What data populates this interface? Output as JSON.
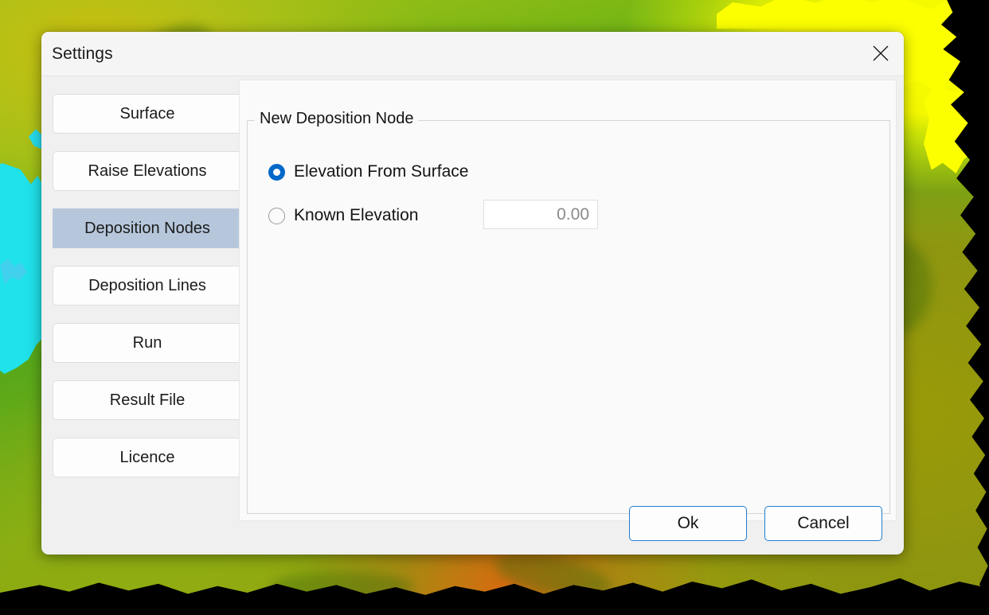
{
  "background": {
    "type": "terrain-elevation-raster",
    "colors": {
      "high": "#fcff00",
      "mid": "#9ab012",
      "low": "#57a81a",
      "water": "#1fe2ea",
      "hot": "#d86a10",
      "nodata": "#000000"
    }
  },
  "dialog": {
    "title": "Settings",
    "close_icon": "close-icon",
    "accent_color": "#0068c8",
    "selected_item_color": "#b6c7dc",
    "sidebar": {
      "items": [
        {
          "label": "Surface",
          "selected": false
        },
        {
          "label": "Raise Elevations",
          "selected": false
        },
        {
          "label": "Deposition Nodes",
          "selected": true
        },
        {
          "label": "Deposition Lines",
          "selected": false
        },
        {
          "label": "Run",
          "selected": false
        },
        {
          "label": "Result File",
          "selected": false
        },
        {
          "label": "Licence",
          "selected": false
        }
      ]
    },
    "content": {
      "group_title": "New Deposition Node",
      "radios": [
        {
          "label": "Elevation From Surface",
          "selected": true
        },
        {
          "label": "Known Elevation",
          "selected": false
        }
      ],
      "elevation_input": {
        "value": "0.00",
        "placeholder": "0.00"
      }
    },
    "footer": {
      "ok_label": "Ok",
      "cancel_label": "Cancel"
    }
  }
}
